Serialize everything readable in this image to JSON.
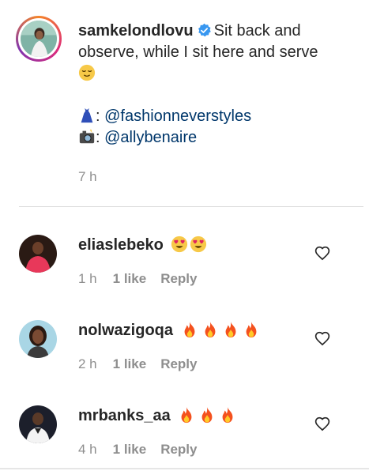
{
  "caption": {
    "username": "samkelondlovu",
    "text": "Sit back and observe, while I sit here and serve",
    "credit_dress_handle": "@fashionneverstyles",
    "credit_photo_handle": "@allybenaire",
    "credit_separator": ": ",
    "time": "7 h",
    "icons": {
      "verified": "verified-badge-icon",
      "relieved": "relieved-face-emoji",
      "dress": "dress-emoji",
      "camera": "camera-flash-emoji"
    }
  },
  "comments": [
    {
      "username": "eliaslebeko",
      "emoji": [
        "heart-eyes-emoji",
        "heart-eyes-emoji"
      ],
      "time": "1 h",
      "likes": "1 like",
      "reply": "Reply"
    },
    {
      "username": "nolwazigoqa",
      "emoji": [
        "fire-emoji",
        "fire-emoji",
        "fire-emoji",
        "fire-emoji"
      ],
      "time": "2 h",
      "likes": "1 like",
      "reply": "Reply"
    },
    {
      "username": "mrbanks_aa",
      "emoji": [
        "fire-emoji",
        "fire-emoji",
        "fire-emoji"
      ],
      "time": "4 h",
      "likes": "1 like",
      "reply": "Reply"
    }
  ],
  "colors": {
    "text": "#262626",
    "muted": "#8e8e8e",
    "mention": "#00376b",
    "verified": "#3897f0"
  }
}
